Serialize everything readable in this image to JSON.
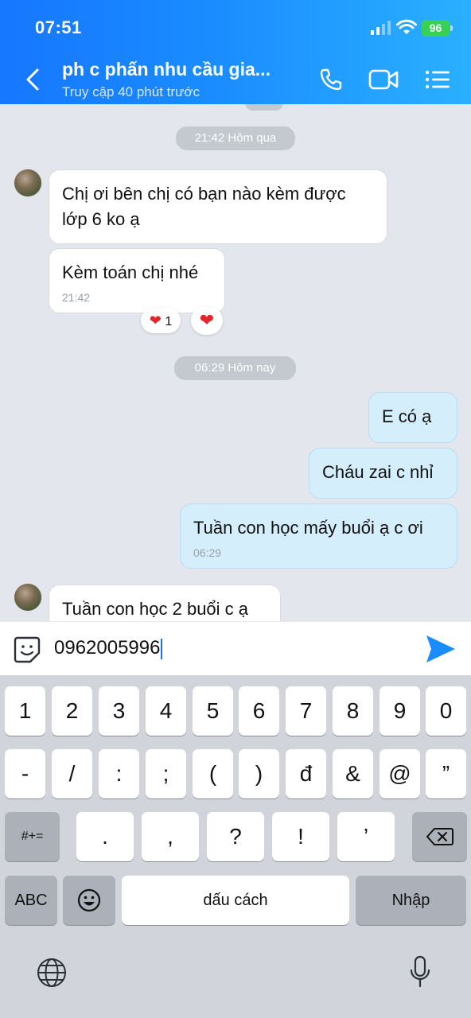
{
  "status_bar": {
    "time": "07:51",
    "battery": "96"
  },
  "header": {
    "title": "ph c phấn nhu cầu gia...",
    "subtitle": "Truy cập 40 phút trước"
  },
  "chat": {
    "date_separator_1": "21:42 Hôm qua",
    "incoming_1": "Chị ơi bên chị có bạn nào kèm được lớp 6 ko ạ",
    "incoming_2": "Kèm toán chị nhé",
    "incoming_2_time": "21:42",
    "reaction_count": "1",
    "date_separator_2": "06:29 Hôm nay",
    "outgoing_1": "E có ạ",
    "outgoing_2": "Cháu zai c nhỉ",
    "outgoing_3": "Tuần con học mấy buổi ạ c ơi",
    "outgoing_3_time": "06:29",
    "incoming_3": "Tuần con học 2 buổi c ạ"
  },
  "composer": {
    "value": "0962005996"
  },
  "keyboard": {
    "row1": [
      "1",
      "2",
      "3",
      "4",
      "5",
      "6",
      "7",
      "8",
      "9",
      "0"
    ],
    "row2": [
      "-",
      "/",
      ":",
      ";",
      "(",
      ")",
      "đ",
      "&",
      "@",
      "”"
    ],
    "row3": [
      "#+=",
      ".",
      ",",
      "?",
      "!",
      "’"
    ],
    "abc": "ABC",
    "space": "dấu cách",
    "enter": "Nhập"
  },
  "colors": {
    "header_start": "#1677ff",
    "header_end": "#2ab0ff",
    "outgoing_bubble": "#d5eefc",
    "send": "#1a8cff"
  }
}
